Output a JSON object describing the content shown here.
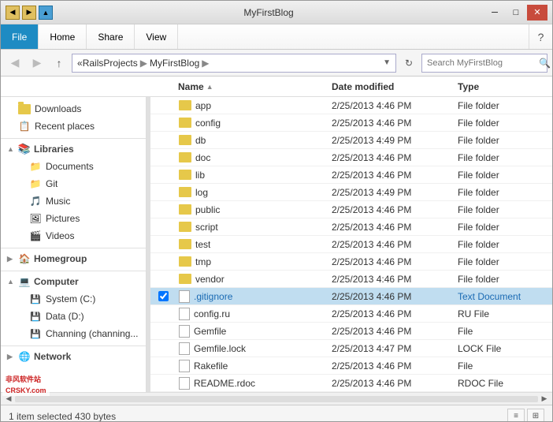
{
  "window": {
    "title": "MyFirstBlog",
    "controls": {
      "minimize": "─",
      "maximize": "□",
      "close": "✕"
    }
  },
  "ribbon": {
    "tabs": [
      {
        "id": "file",
        "label": "File",
        "active": true
      },
      {
        "id": "home",
        "label": "Home"
      },
      {
        "id": "share",
        "label": "Share"
      },
      {
        "id": "view",
        "label": "View"
      }
    ],
    "help_icon": "?"
  },
  "address_bar": {
    "back_disabled": false,
    "forward_disabled": true,
    "path_segments": [
      "RailsProjects",
      "MyFirstBlog"
    ],
    "path_separator": "▶",
    "search_placeholder": "Search MyFirstBlog"
  },
  "columns": {
    "name": "Name",
    "date_modified": "Date modified",
    "type": "Type"
  },
  "sidebar": {
    "items": [
      {
        "id": "downloads",
        "label": "Downloads",
        "type": "folder",
        "indent": 1
      },
      {
        "id": "recent",
        "label": "Recent places",
        "type": "special",
        "indent": 1
      },
      {
        "id": "libraries",
        "label": "Libraries",
        "type": "group",
        "indent": 0
      },
      {
        "id": "documents",
        "label": "Documents",
        "type": "lib",
        "indent": 2
      },
      {
        "id": "git",
        "label": "Git",
        "type": "lib",
        "indent": 2
      },
      {
        "id": "music",
        "label": "Music",
        "type": "lib",
        "indent": 2
      },
      {
        "id": "pictures",
        "label": "Pictures",
        "type": "lib",
        "indent": 2
      },
      {
        "id": "videos",
        "label": "Videos",
        "type": "lib",
        "indent": 2
      },
      {
        "id": "homegroup",
        "label": "Homegroup",
        "type": "group",
        "indent": 0
      },
      {
        "id": "computer",
        "label": "Computer",
        "type": "group",
        "indent": 0
      },
      {
        "id": "system-c",
        "label": "System (C:)",
        "type": "drive",
        "indent": 2
      },
      {
        "id": "data-d",
        "label": "Data (D:)",
        "type": "drive",
        "indent": 2
      },
      {
        "id": "channing",
        "label": "Channing (channing...",
        "type": "drive",
        "indent": 2
      },
      {
        "id": "network",
        "label": "Network",
        "type": "group",
        "indent": 0
      }
    ]
  },
  "files": [
    {
      "name": "app",
      "date": "2/25/2013 4:46 PM",
      "type": "File folder",
      "is_folder": true,
      "selected": false
    },
    {
      "name": "config",
      "date": "2/25/2013 4:46 PM",
      "type": "File folder",
      "is_folder": true,
      "selected": false
    },
    {
      "name": "db",
      "date": "2/25/2013 4:49 PM",
      "type": "File folder",
      "is_folder": true,
      "selected": false
    },
    {
      "name": "doc",
      "date": "2/25/2013 4:46 PM",
      "type": "File folder",
      "is_folder": true,
      "selected": false
    },
    {
      "name": "lib",
      "date": "2/25/2013 4:46 PM",
      "type": "File folder",
      "is_folder": true,
      "selected": false
    },
    {
      "name": "log",
      "date": "2/25/2013 4:49 PM",
      "type": "File folder",
      "is_folder": true,
      "selected": false
    },
    {
      "name": "public",
      "date": "2/25/2013 4:46 PM",
      "type": "File folder",
      "is_folder": true,
      "selected": false
    },
    {
      "name": "script",
      "date": "2/25/2013 4:46 PM",
      "type": "File folder",
      "is_folder": true,
      "selected": false
    },
    {
      "name": "test",
      "date": "2/25/2013 4:46 PM",
      "type": "File folder",
      "is_folder": true,
      "selected": false
    },
    {
      "name": "tmp",
      "date": "2/25/2013 4:46 PM",
      "type": "File folder",
      "is_folder": true,
      "selected": false
    },
    {
      "name": "vendor",
      "date": "2/25/2013 4:46 PM",
      "type": "File folder",
      "is_folder": true,
      "selected": false
    },
    {
      "name": ".gitignore",
      "date": "2/25/2013 4:46 PM",
      "type": "Text Document",
      "is_folder": false,
      "selected": true,
      "checked": true
    },
    {
      "name": "config.ru",
      "date": "2/25/2013 4:46 PM",
      "type": "RU File",
      "is_folder": false,
      "selected": false
    },
    {
      "name": "Gemfile",
      "date": "2/25/2013 4:46 PM",
      "type": "File",
      "is_folder": false,
      "selected": false
    },
    {
      "name": "Gemfile.lock",
      "date": "2/25/2013 4:47 PM",
      "type": "LOCK File",
      "is_folder": false,
      "selected": false
    },
    {
      "name": "Rakefile",
      "date": "2/25/2013 4:46 PM",
      "type": "File",
      "is_folder": false,
      "selected": false
    },
    {
      "name": "README.rdoc",
      "date": "2/25/2013 4:46 PM",
      "type": "RDOC File",
      "is_folder": false,
      "selected": false
    }
  ],
  "status": {
    "text": "1 item selected  430 bytes"
  },
  "colors": {
    "selected_row_bg": "#c0ddf0",
    "selected_row_text": "#1a6ab3",
    "folder_icon": "#e6c84a",
    "ribbon_active": "#1e8bc3"
  }
}
